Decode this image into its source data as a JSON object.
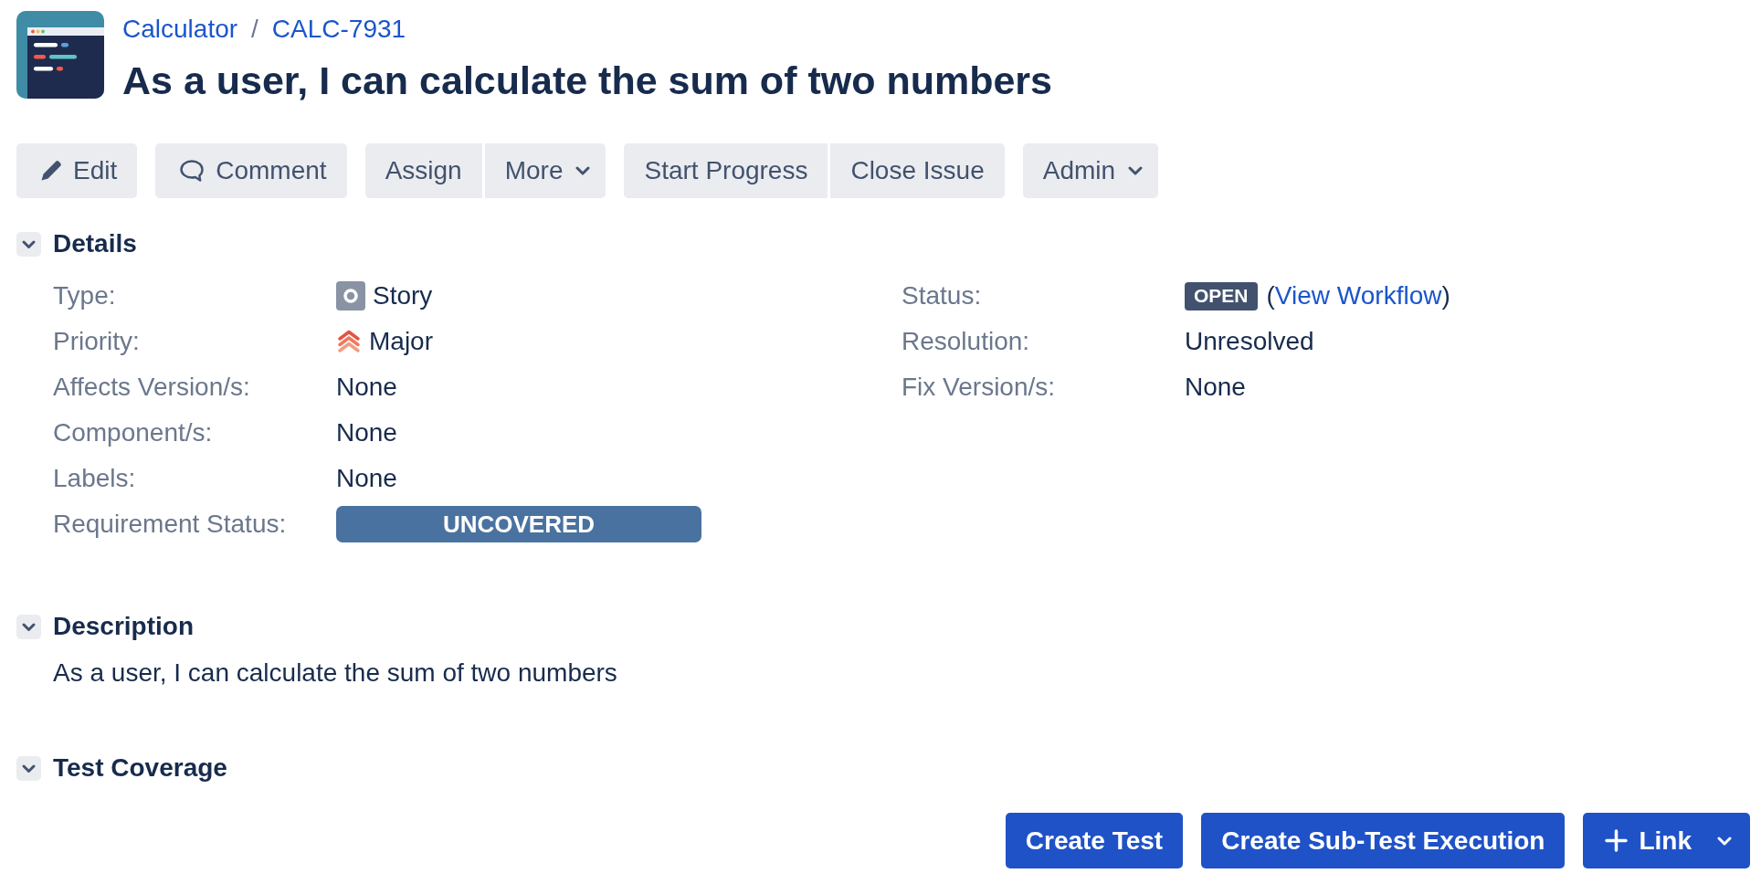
{
  "header": {
    "breadcrumbs": [
      {
        "kind": "link",
        "label": "Calculator"
      },
      {
        "kind": "separator",
        "label": "/"
      },
      {
        "kind": "link",
        "label": "CALC-7931"
      }
    ],
    "title": "As a user, I can calculate the sum of two numbers"
  },
  "toolbar": [
    {
      "buttons": [
        {
          "label": "Edit",
          "kind": "edit"
        }
      ]
    },
    {
      "buttons": [
        {
          "label": "Comment",
          "kind": "comment"
        }
      ]
    },
    {
      "buttons": [
        {
          "label": "Assign",
          "kind": "plain"
        },
        {
          "label": "More",
          "kind": "dropdown"
        }
      ]
    },
    {
      "buttons": [
        {
          "label": "Start Progress",
          "kind": "plain"
        },
        {
          "label": "Close Issue",
          "kind": "plain"
        }
      ]
    },
    {
      "buttons": [
        {
          "label": "Admin",
          "kind": "dropdown"
        }
      ]
    }
  ],
  "details": {
    "title": "Details",
    "expanded": true,
    "left": [
      {
        "label": "Type:",
        "kind": "type",
        "value": "Story"
      },
      {
        "label": "Priority:",
        "kind": "priority",
        "value": "Major"
      },
      {
        "label": "Affects Version/s:",
        "kind": "text",
        "value": "None"
      },
      {
        "label": "Component/s:",
        "kind": "text",
        "value": "None"
      },
      {
        "label": "Labels:",
        "kind": "text",
        "value": "None"
      },
      {
        "label": "Requirement Status:",
        "kind": "bar",
        "value": "UNCOVERED"
      }
    ],
    "right": [
      {
        "label": "Status:",
        "kind": "status",
        "value": "OPEN",
        "note": {
          "before": "(",
          "link": "View Workflow",
          "after": ")"
        }
      },
      {
        "label": "Resolution:",
        "kind": "text",
        "value": "Unresolved"
      },
      {
        "label": "Fix Version/s:",
        "kind": "text",
        "value": "None"
      }
    ]
  },
  "description": {
    "title": "Description",
    "expanded": true,
    "text": "As a user, I can calculate the sum of two numbers"
  },
  "test_coverage": {
    "title": "Test Coverage",
    "expanded": true,
    "buttons": [
      {
        "label": "Create Test",
        "kind": "plain"
      },
      {
        "label": "Create Sub-Test Execution",
        "kind": "plain"
      },
      {
        "label": "Link",
        "kind": "add-dropdown"
      }
    ]
  }
}
